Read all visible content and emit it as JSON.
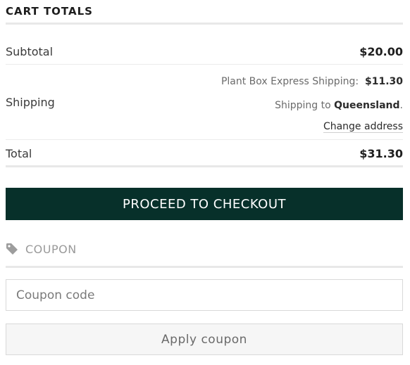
{
  "cart_totals": {
    "title": "CART TOTALS",
    "subtotal": {
      "label": "Subtotal",
      "value": "$20.00"
    },
    "shipping": {
      "label": "Shipping",
      "method_name": "Plant Box Express Shipping:",
      "method_price": "$11.30",
      "destination_prefix": "Shipping to",
      "destination": "Queensland",
      "destination_suffix": ".",
      "change_address": "Change address"
    },
    "total": {
      "label": "Total",
      "value": "$31.30"
    },
    "checkout_button": "PROCEED TO CHECKOUT"
  },
  "coupon": {
    "heading": "COUPON",
    "icon": "tag-icon",
    "input_placeholder": "Coupon code",
    "input_value": "",
    "apply_button": "Apply coupon"
  },
  "colors": {
    "checkout_bg": "#07302a",
    "checkout_text": "#ffffff",
    "divider": "#e8e8e8"
  }
}
